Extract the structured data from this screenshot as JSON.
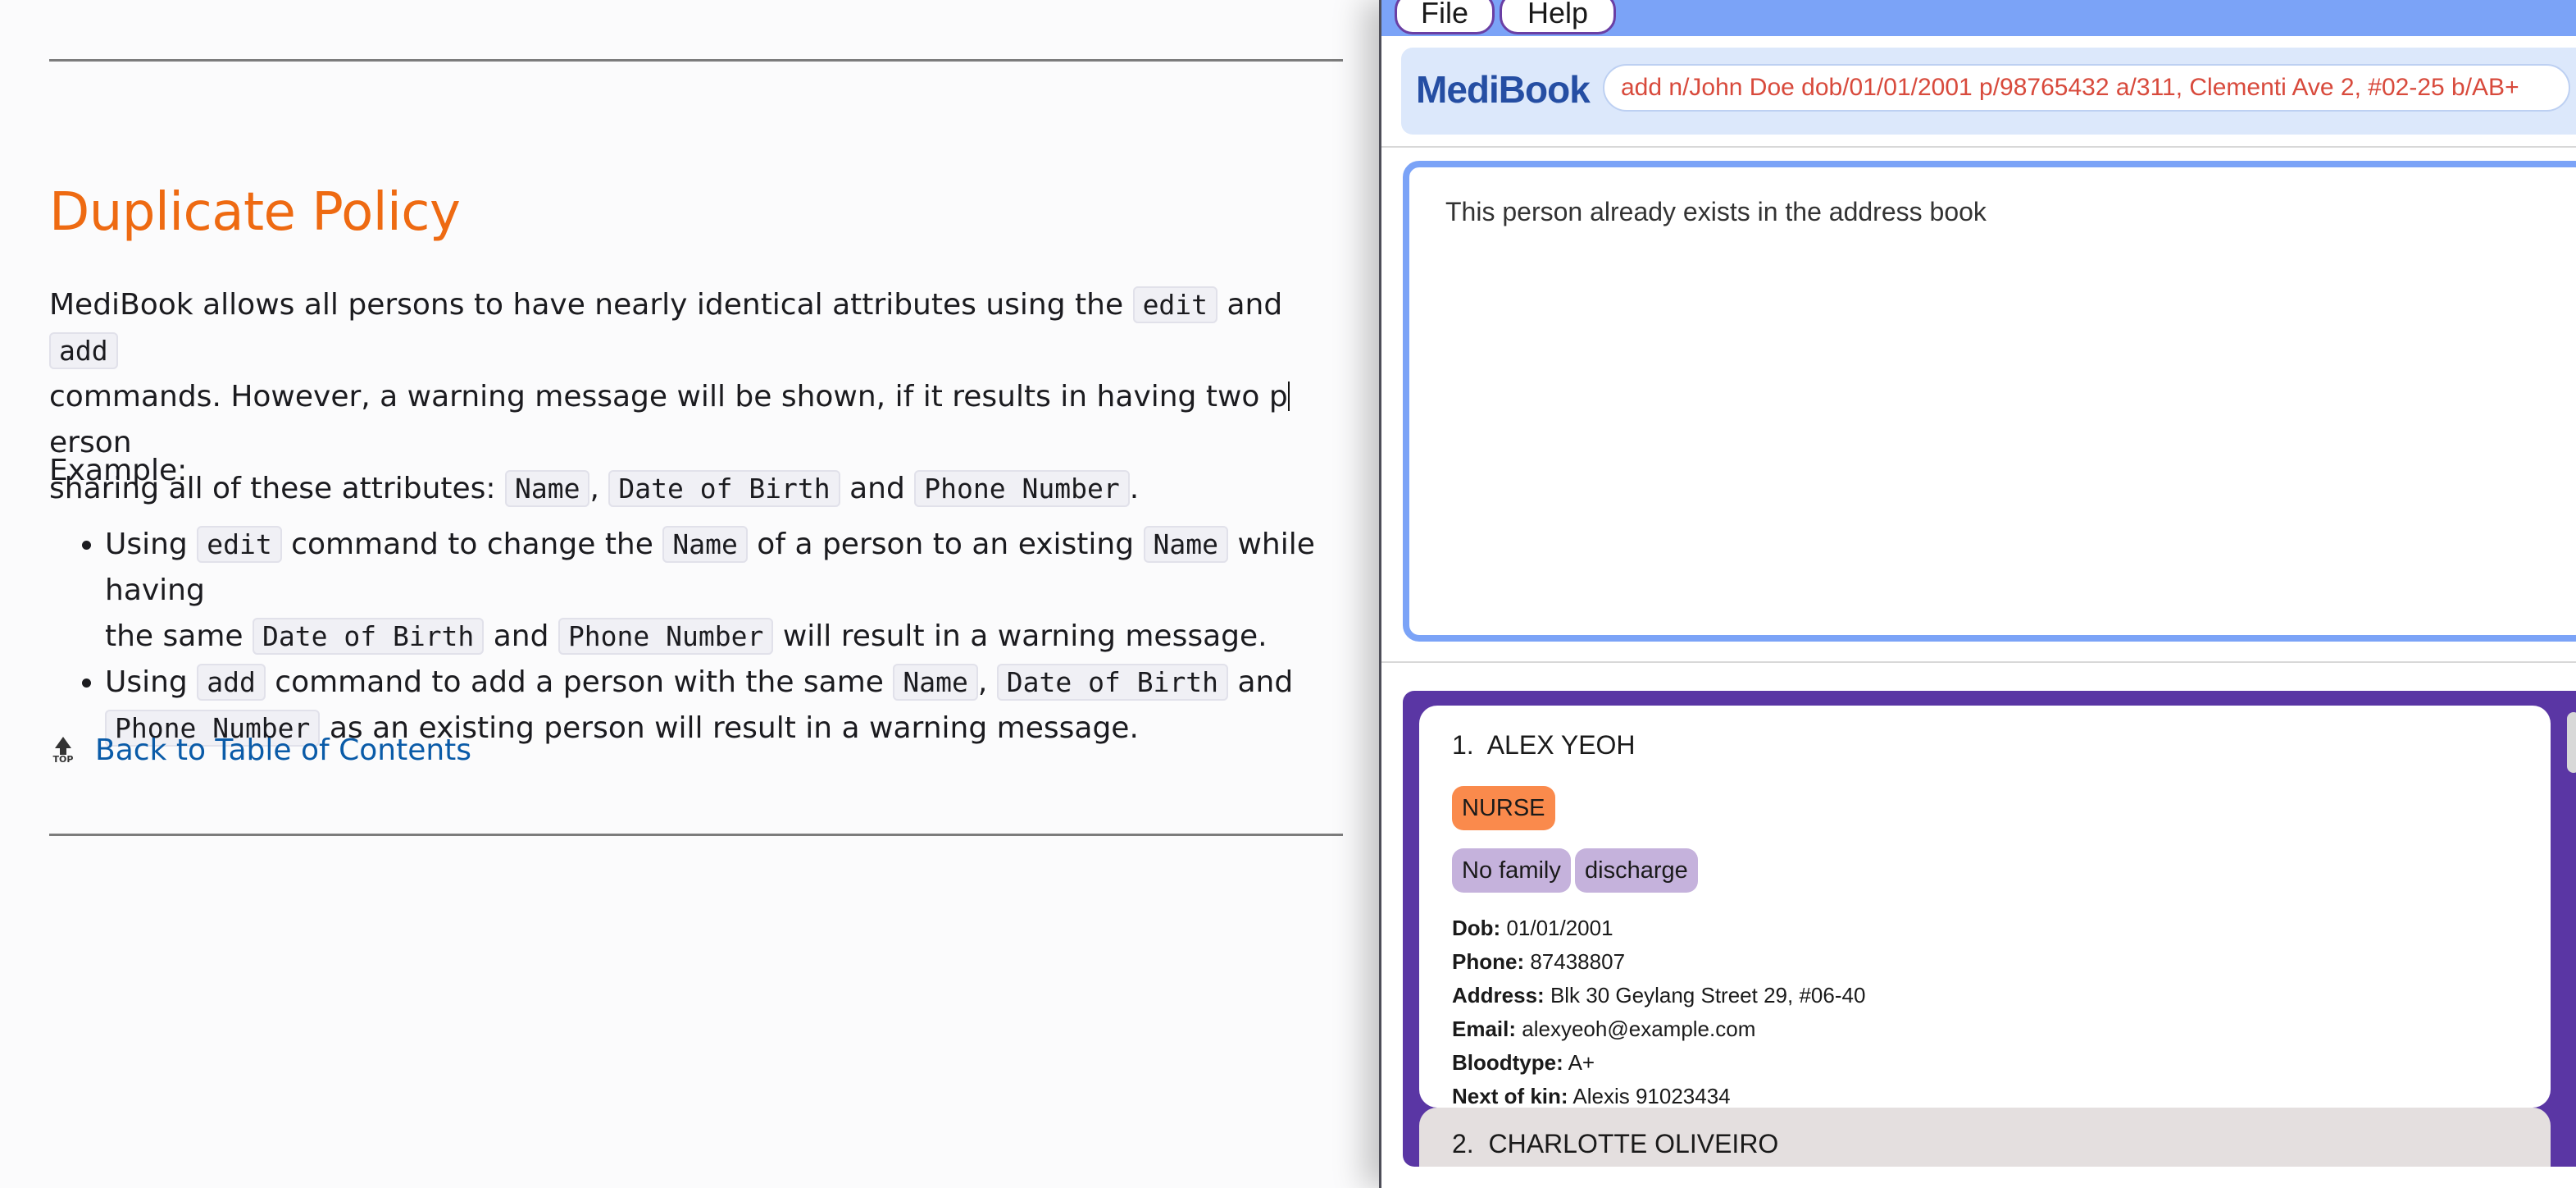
{
  "doc": {
    "heading": "Duplicate Policy",
    "para1": {
      "t1": "MediBook allows all persons to have nearly identical attributes using the",
      "c1": "edit",
      "t2": "and",
      "c2": "add",
      "t3": "commands. However, a warning message will be shown, if it results in having two p",
      "t3b": "erson",
      "t4": "sharing all of these attributes:",
      "c3": "Name",
      "c4": "Date of Birth",
      "t5": "and",
      "c5": "Phone Number"
    },
    "example_label": "Example:",
    "bullets": {
      "b1": {
        "t1": "Using",
        "c1": "edit",
        "t2": "command to change the",
        "c2": "Name",
        "t3": "of a person to an existing",
        "c3": "Name",
        "t4": "while having",
        "t5": "the same",
        "c4": "Date of Birth",
        "t6": "and",
        "c5": "Phone Number",
        "t7": "will result in a warning message."
      },
      "b2": {
        "t1": "Using",
        "c1": "add",
        "t2": "command to add a person with the same",
        "c2": "Name",
        "c3": "Date of Birth",
        "t3": "and",
        "c4": "Phone Number",
        "t4": "as an existing person will result in a warning message."
      }
    },
    "back_link": "Back to Table of Contents",
    "top_icon_label": "TOP"
  },
  "app": {
    "menu": {
      "file": "File",
      "help": "Help"
    },
    "brand": "MediBook",
    "command_value": "add n/John Doe dob/01/01/2001 p/98765432 a/311, Clementi Ave 2, #02-25 b/AB+",
    "result_message": "This person already exists in the address book",
    "persons": [
      {
        "index": "1.",
        "name": "ALEX YEOH",
        "role": "NURSE",
        "tags": [
          "No family",
          "discharge"
        ],
        "dob_label": "Dob:",
        "dob": "01/01/2001",
        "phone_label": "Phone:",
        "phone": "87438807",
        "address_label": "Address:",
        "address": "Blk 30 Geylang Street 29, #06-40",
        "email_label": "Email:",
        "email": "alexyeoh@example.com",
        "bloodtype_label": "Bloodtype:",
        "bloodtype": "A+",
        "nok_label": "Next of kin:",
        "nok": "Alexis 91023434"
      },
      {
        "index": "2.",
        "name": "CHARLOTTE OLIVEIRO"
      }
    ]
  },
  "colors": {
    "heading": "#ee6a12",
    "link": "#0a5ba8",
    "menubar": "#7ba3f7",
    "brand": "#254ea3",
    "command_text": "#d84a3c",
    "list_bg": "#5a36a4",
    "role_tag": "#fa8a4c",
    "tag": "#c5b2dc"
  }
}
